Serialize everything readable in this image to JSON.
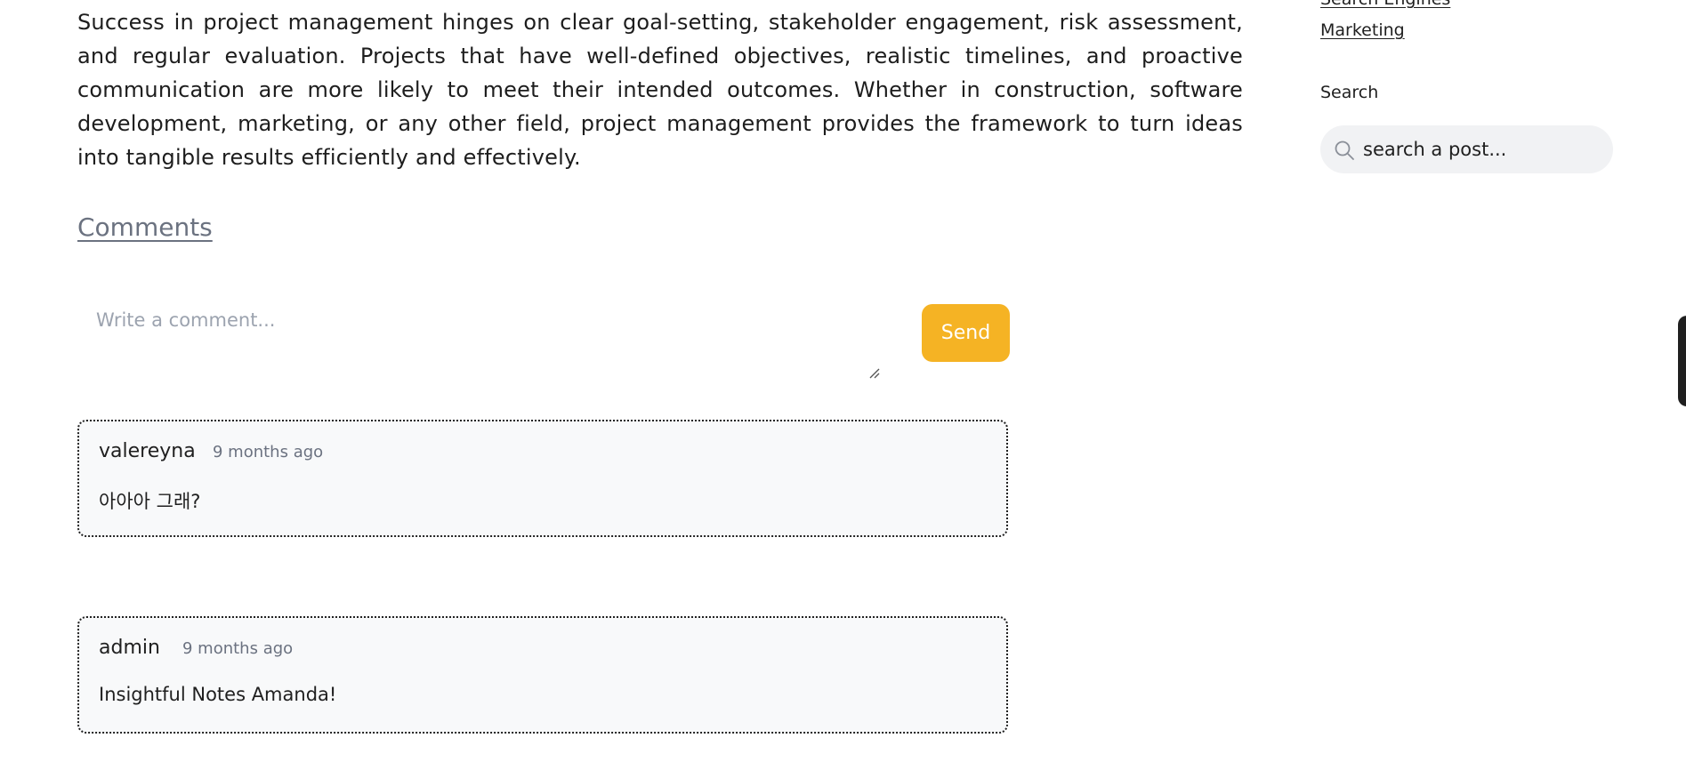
{
  "article": {
    "paragraph": "Success in project management hinges on clear goal-setting, stakeholder engagement, risk assessment, and regular evaluation. Projects that have well-defined objectives, realistic timelines, and proactive communication are more likely to meet their intended outcomes. Whether in construction, software development, marketing, or any other field, project management provides the framework to turn ideas into tangible results efficiently and effectively."
  },
  "comments_section": {
    "heading": "Comments",
    "input_placeholder": "Write a comment...",
    "send_label": "Send",
    "comments": [
      {
        "author": "valereyna",
        "time": "9 months ago",
        "text": "아아아 그래?"
      },
      {
        "author": "admin",
        "time": "9 months ago",
        "text": "Insightful Notes Amanda!"
      }
    ]
  },
  "sidebar": {
    "categories": [
      "Search Engines",
      "Marketing"
    ],
    "search_heading": "Search",
    "search_placeholder": "search a post..."
  },
  "colors": {
    "accent": "#f5b324",
    "card_background": "#f8f9fa",
    "muted_text": "#6b7280",
    "search_background": "#f1f2f4"
  }
}
